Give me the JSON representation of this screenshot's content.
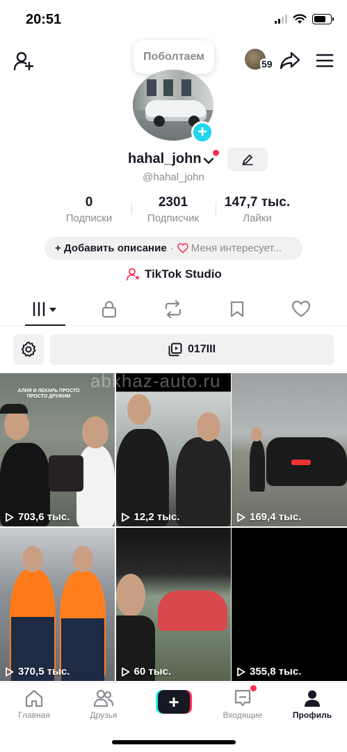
{
  "status_bar": {
    "time": "20:51",
    "icons": [
      "signal-icon",
      "wifi-icon",
      "battery-icon"
    ]
  },
  "top_bar": {
    "add_friend_icon": "person-plus-icon",
    "status_bubble": "Поболтаем",
    "profile_visitors": "59",
    "share_icon": "share-arrow-icon",
    "menu_icon": "hamburger-menu-icon"
  },
  "profile": {
    "display_name": "hahal_john",
    "handle": "@hahal_john",
    "avatar_plus_icon": "plus-icon",
    "edit_icon": "pencil-icon"
  },
  "stats": [
    {
      "value": "0",
      "label": "Подписки"
    },
    {
      "value": "2301",
      "label": "Подписчик"
    },
    {
      "value": "147,7 тыс.",
      "label": "Лайки"
    }
  ],
  "bio": {
    "add_description": "+ Добавить описание",
    "separator": "·",
    "interests": "Меня интересует..."
  },
  "studio": {
    "label": "TikTok Studio",
    "icon": "person-star-icon"
  },
  "tabs": [
    {
      "name": "videos",
      "icon": "grid-bars-icon",
      "active": true
    },
    {
      "name": "private",
      "icon": "lock-icon",
      "active": false
    },
    {
      "name": "reposts",
      "icon": "repost-icon",
      "active": false
    },
    {
      "name": "favorites",
      "icon": "bookmark-icon",
      "active": false
    },
    {
      "name": "liked",
      "icon": "heart-icon",
      "active": false
    }
  ],
  "filter": {
    "settings_icon": "gear-icon",
    "playlist_label": "017III",
    "playlist_icon": "playlist-icon"
  },
  "videos": [
    {
      "views": "703,6 тыс.",
      "caption": "АЛИЯ И ЛЕКАРЬ ПРОСТО ПРОСТО ДРУЖИМ"
    },
    {
      "views": "12,2 тыс."
    },
    {
      "views": "169,4 тыс."
    },
    {
      "views": "370,5 тыс."
    },
    {
      "views": "60 тыс."
    },
    {
      "views": "355,8 тыс."
    }
  ],
  "watermark": "abkhaz-auto.ru",
  "bottom_nav": [
    {
      "label": "Главная",
      "icon": "home-icon"
    },
    {
      "label": "Друзья",
      "icon": "friends-icon"
    },
    {
      "label": "",
      "icon": "plus-icon"
    },
    {
      "label": "Входящие",
      "icon": "inbox-icon"
    },
    {
      "label": "Профиль",
      "icon": "profile-icon"
    }
  ],
  "colors": {
    "accent_red": "#fe2c55",
    "accent_cyan": "#25f4ee",
    "plus_badge": "#20d5ec",
    "text_primary": "#161823",
    "text_secondary": "#8a8b91"
  }
}
